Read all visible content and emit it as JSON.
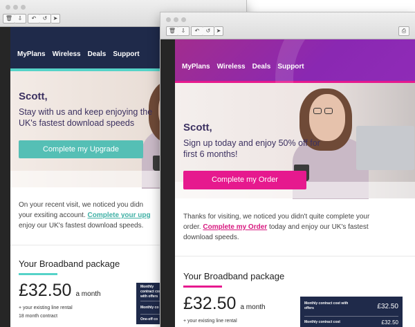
{
  "toolbar": {
    "delete_icon": "trash-icon",
    "archive_icon": "tray-icon",
    "reply_icon": "reply-icon",
    "reply_all_icon": "reply-all-icon",
    "forward_icon": "forward-icon",
    "print_icon": "print-icon"
  },
  "colors": {
    "teal": "#55bfb5",
    "navy": "#1f2a4a",
    "magenta": "#e6198e",
    "purple": "#8a28b2"
  },
  "back_email": {
    "nav": [
      "MyPlans",
      "Wireless",
      "Deals",
      "Support"
    ],
    "greeting": "Scott,",
    "pitch_line1": "Stay with us and keep enjoying the",
    "pitch_line2": "UK's fastest download speeds",
    "cta": "Complete my Upgrade",
    "intro_before": "On your recent visit, we noticed you didn",
    "intro_line2": "your exsiting account.",
    "intro_link": "Complete your upg",
    "intro_after": "enjoy our UK's fastest download speeds.",
    "pkg_title": "Your Broadband package",
    "price": "£32.50",
    "per": "a month",
    "note1": "+ your existing line rental",
    "note2": "18 month contract",
    "box_row1": "Monthly contract cost with offers",
    "box_row2": "Monthly co",
    "box_row3": "One-off co"
  },
  "front_email": {
    "nav": [
      "MyPlans",
      "Wireless",
      "Deals",
      "Support"
    ],
    "greeting": "Scott,",
    "pitch_line1": "Sign up today and enjoy 50% off for",
    "pitch_line2": "first 6 months!",
    "cta": "Complete my Order",
    "intro_before": "Thanks for visiting, we noticed you didn't quite complete your",
    "intro_prefix": "order.",
    "intro_link": "Complete my Order",
    "intro_after": "today and enjoy our UK's fastest",
    "intro_line3": "download speeds.",
    "pkg_title": "Your Broadband package",
    "price": "£32.50",
    "per": "a month",
    "note1": "+ your existing line rental",
    "box_row1": "Monthly contract cost with offers",
    "box_val1": "£32.50",
    "box_row2": "Monthly contract cost",
    "box_val2": "£32.50"
  }
}
